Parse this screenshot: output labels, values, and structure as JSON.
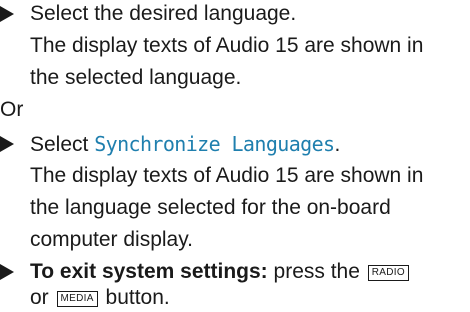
{
  "step1": {
    "text": "Select the desired language.",
    "result_line1": "The display texts of Audio 15 are shown in",
    "result_line2": "the selected language."
  },
  "or_label": "Or",
  "step2": {
    "prefix": "Select ",
    "display_text": "Synchronize Languages",
    "suffix": ".",
    "result_line1": "The display texts of Audio 15 are shown in",
    "result_line2": "the language selected for the on-board",
    "result_line3": "computer display."
  },
  "step3": {
    "bold_label": "To exit system settings:",
    "text_a": " press the ",
    "key1": "RADIO",
    "line2_prefix": "or ",
    "key2": "MEDIA",
    "line2_suffix": " button."
  },
  "colors": {
    "display_text": "#1f7fae",
    "text": "#1a1a1a",
    "background": "#ffffff"
  }
}
